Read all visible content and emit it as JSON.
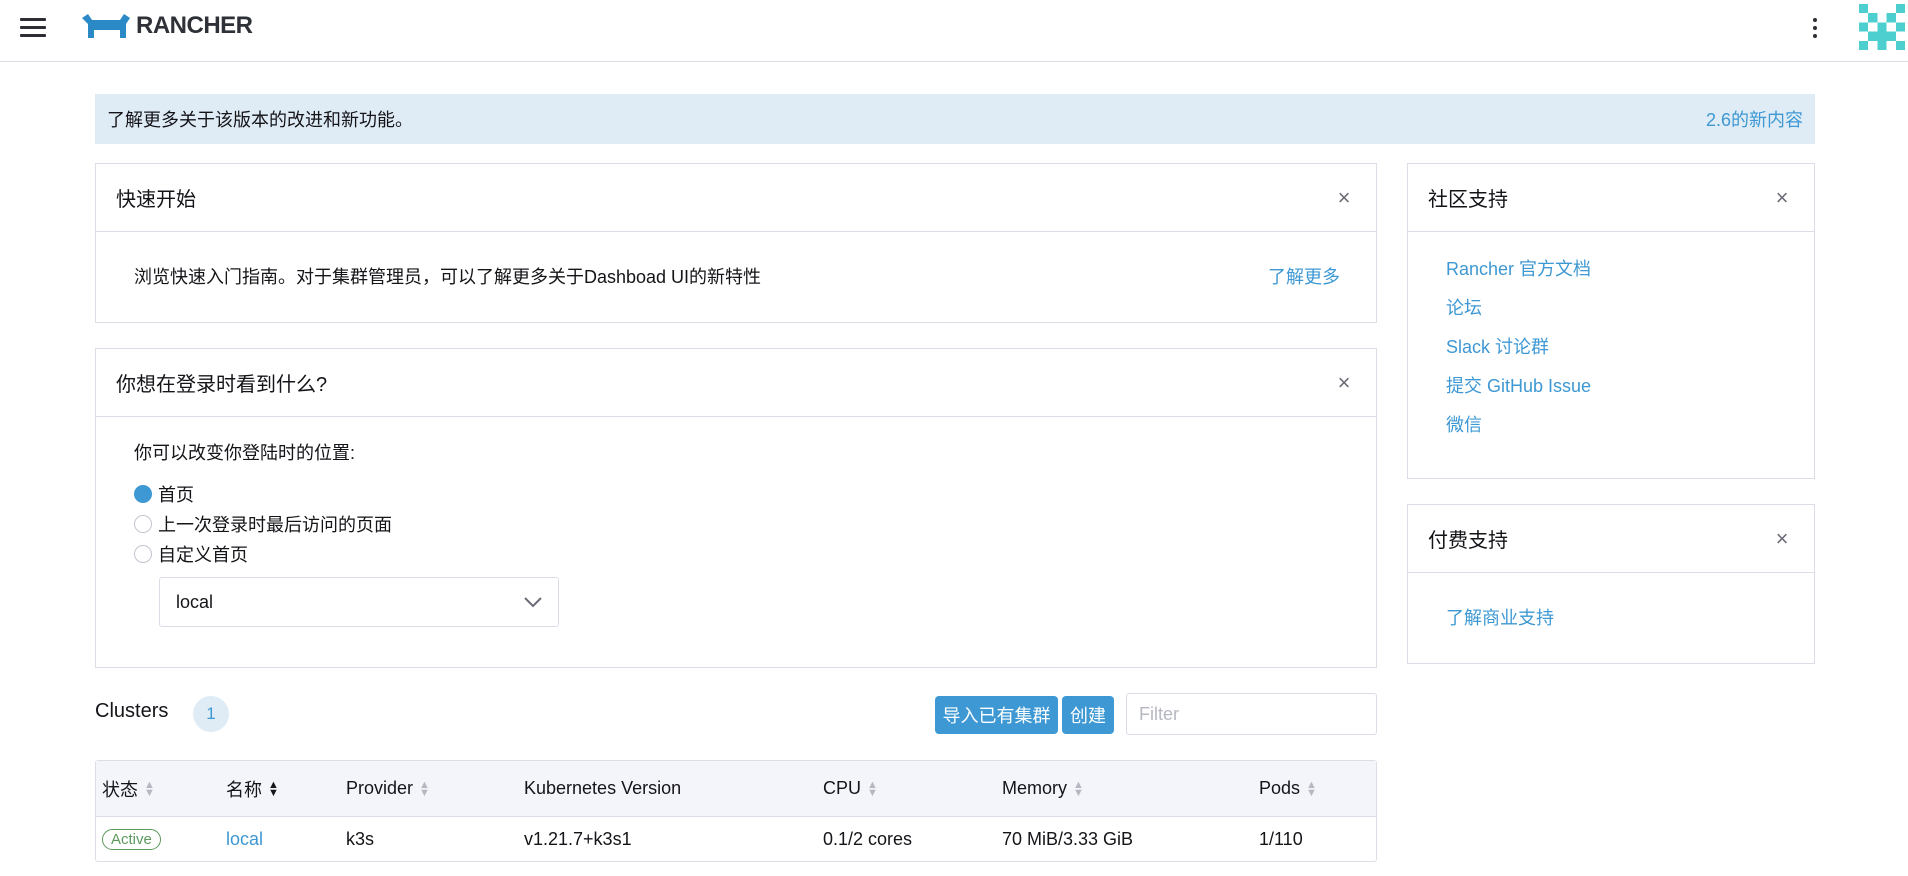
{
  "header": {
    "logo_text": "RANCHER"
  },
  "banner": {
    "text": "了解更多关于该版本的改进和新功能。",
    "link": "2.6的新内容"
  },
  "quick_start": {
    "title": "快速开始",
    "text": "浏览快速入门指南。对于集群管理员，可以了解更多关于Dashboad UI的新特性",
    "link": "了解更多"
  },
  "login_pref": {
    "title": "你想在登录时看到什么?",
    "label": "你可以改变你登陆时的位置:",
    "options": [
      "首页",
      "上一次登录时最后访问的页面",
      "自定义首页"
    ],
    "selected_index": 0,
    "select_value": "local"
  },
  "community": {
    "title": "社区支持",
    "links": [
      "Rancher 官方文档",
      "论坛",
      "Slack 讨论群",
      "提交 GitHub Issue",
      "微信"
    ]
  },
  "paid": {
    "title": "付费支持",
    "link": "了解商业支持"
  },
  "clusters": {
    "title": "Clusters",
    "count": "1",
    "import_label": "导入已有集群",
    "create_label": "创建",
    "filter_placeholder": "Filter",
    "columns": [
      "状态",
      "名称",
      "Provider",
      "Kubernetes Version",
      "CPU",
      "Memory",
      "Pods"
    ],
    "rows": [
      {
        "state": "Active",
        "name": "local",
        "provider": "k3s",
        "version": "v1.21.7+k3s1",
        "cpu": "0.1/2 cores",
        "memory": "70 MiB/3.33 GiB",
        "pods": "1/110"
      }
    ]
  },
  "colors": {
    "accent": "#3d98d3",
    "banner_bg": "#e0ecf5",
    "active_green": "#5d995d"
  }
}
